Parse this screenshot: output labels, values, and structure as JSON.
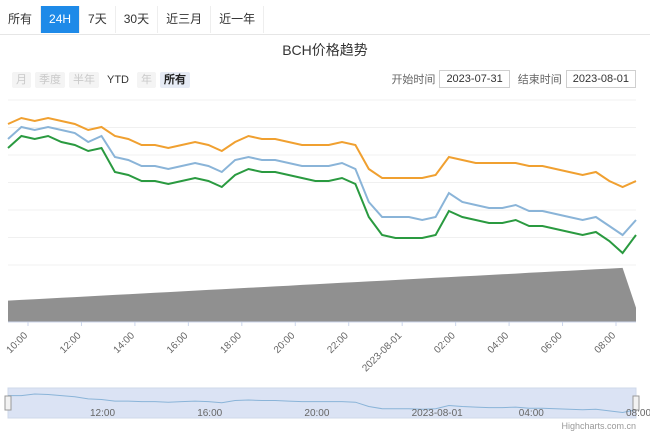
{
  "tabs": [
    {
      "label": "所有",
      "active": false
    },
    {
      "label": "24H",
      "active": true
    },
    {
      "label": "7天",
      "active": false
    },
    {
      "label": "30天",
      "active": false
    },
    {
      "label": "近三月",
      "active": false
    },
    {
      "label": "近一年",
      "active": false
    }
  ],
  "range_buttons": [
    {
      "label": "月",
      "state": "disabled"
    },
    {
      "label": "季度",
      "state": "disabled"
    },
    {
      "label": "半年",
      "state": "disabled"
    },
    {
      "label": "YTD",
      "state": "enabled"
    },
    {
      "label": "年",
      "state": "disabled"
    },
    {
      "label": "所有",
      "state": "active"
    }
  ],
  "date_range": {
    "start_label": "开始时间",
    "start": "2023-07-31",
    "end_label": "结束时间",
    "end": "2023-08-01"
  },
  "credits": "Highcharts.com.cn",
  "chart_data": {
    "type": "line",
    "title": "BCH价格趋势",
    "x_tick_labels": [
      "10:00",
      "12:00",
      "14:00",
      "16:00",
      "18:00",
      "20:00",
      "22:00",
      "2023-08-01",
      "02:00",
      "04:00",
      "06:00",
      "08:00"
    ],
    "navigator_labels": [
      "12:00",
      "16:00",
      "20:00",
      "2023-08-01",
      "04:00",
      "08:00"
    ],
    "x": [
      0,
      0.5,
      1,
      1.5,
      2,
      2.5,
      3,
      3.5,
      4,
      4.5,
      5,
      5.5,
      6,
      6.5,
      7,
      7.5,
      8,
      8.5,
      9,
      9.5,
      10,
      10.5,
      11,
      11.5,
      12,
      12.5,
      13,
      13.5,
      14,
      14.5,
      15,
      15.5,
      16,
      16.5,
      17,
      17.5,
      18,
      18.5,
      19,
      19.5,
      20,
      20.5,
      21,
      21.5,
      22,
      22.5,
      23,
      23.5
    ],
    "series": [
      {
        "color": "#f0a030",
        "values": [
          97,
          99,
          98,
          99,
          98,
          97,
          95,
          96,
          93,
          92,
          90,
          90,
          89,
          90,
          91,
          90,
          88,
          91,
          93,
          92,
          92,
          91,
          90,
          90,
          90,
          91,
          90,
          82,
          79,
          79,
          79,
          79,
          80,
          86,
          85,
          84,
          84,
          84,
          84,
          83,
          83,
          82,
          81,
          80,
          81,
          78,
          76,
          78
        ]
      },
      {
        "color": "#8ab4d8",
        "values": [
          92,
          96,
          95,
          96,
          95,
          94,
          91,
          93,
          86,
          85,
          83,
          83,
          82,
          83,
          84,
          83,
          81,
          85,
          86,
          85,
          85,
          84,
          83,
          83,
          83,
          84,
          82,
          71,
          66,
          66,
          66,
          65,
          66,
          74,
          71,
          70,
          69,
          69,
          70,
          68,
          68,
          67,
          66,
          65,
          66,
          63,
          60,
          65
        ]
      },
      {
        "color": "#2a9a40",
        "values": [
          89,
          93,
          92,
          93,
          91,
          90,
          88,
          89,
          81,
          80,
          78,
          78,
          77,
          78,
          79,
          78,
          76,
          80,
          82,
          81,
          81,
          80,
          79,
          78,
          78,
          79,
          77,
          66,
          60,
          59,
          59,
          59,
          60,
          68,
          66,
          65,
          64,
          64,
          65,
          63,
          63,
          62,
          61,
          60,
          61,
          58,
          54,
          60
        ]
      }
    ],
    "volume": {
      "color": "#909090",
      "values": [
        30,
        31,
        32,
        33,
        34,
        35,
        36,
        37,
        38,
        39,
        40,
        41,
        42,
        43,
        44,
        45,
        46,
        47,
        48,
        49,
        50,
        51,
        52,
        53,
        54,
        55,
        56,
        57,
        58,
        59,
        60,
        61,
        62,
        63,
        64,
        65,
        66,
        67,
        68,
        69,
        70,
        71,
        72,
        73,
        74,
        75,
        76,
        20
      ]
    },
    "navigator_series": [
      86,
      86,
      89,
      88,
      86,
      84,
      80,
      79,
      76,
      76,
      75,
      75,
      74,
      75,
      76,
      75,
      73,
      77,
      78,
      77,
      77,
      76,
      75,
      75,
      75,
      75,
      74,
      66,
      62,
      62,
      62,
      61,
      62,
      68,
      66,
      65,
      64,
      64,
      65,
      63,
      63,
      62,
      61,
      60,
      61,
      58,
      55,
      60
    ]
  }
}
